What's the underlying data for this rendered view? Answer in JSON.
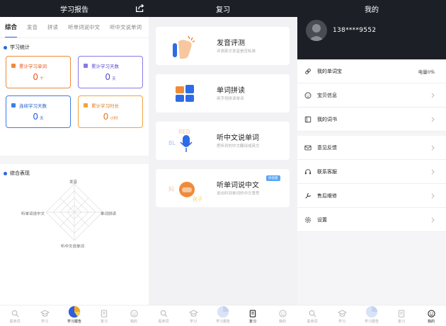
{
  "panel1": {
    "title": "学习报告",
    "tabs": [
      "综合",
      "发音",
      "拼读",
      "听单词说中文",
      "听中文说单词"
    ],
    "stats_title": "学习统计",
    "stats": [
      {
        "label": "累计学习单词",
        "value": "0",
        "unit": "个",
        "color": "#f08a3a",
        "text_color": "#e25c1f"
      },
      {
        "label": "累计学习天数",
        "value": "0",
        "unit": "天",
        "color": "#8b78e6",
        "text_color": "#5b4bd1"
      },
      {
        "label": "连续学习天数",
        "value": "0",
        "unit": "天",
        "color": "#3a7ee8",
        "text_color": "#2560d0"
      },
      {
        "label": "累计学习时长",
        "value": "0",
        "unit": "小时",
        "color": "#f0a43a",
        "text_color": "#e07a1f"
      }
    ],
    "perf_title": "综合表现",
    "radar_labels": {
      "top": "发音",
      "left": "听单词说中文",
      "right": "单词拼读",
      "bottom": "听中文说单词"
    }
  },
  "panel2": {
    "title": "复习",
    "cards": [
      {
        "title": "发音评测",
        "sub": "评测英文发音是否标准"
      },
      {
        "title": "单词拼读",
        "sub": "用字母拼读单词"
      },
      {
        "title": "听中文说单词",
        "sub": "把听到的中文翻译成英文"
      },
      {
        "title": "听单词说中文",
        "sub": "说出听到单词的中文意思",
        "badge": "体验版"
      }
    ]
  },
  "panel3": {
    "title": "我的",
    "phone": "138****9552",
    "menu_group1": [
      {
        "label": "我的单词宝",
        "extra": "电量0%",
        "icon": "link-icon"
      },
      {
        "label": "宝贝信息",
        "icon": "baby-icon"
      },
      {
        "label": "我的词书",
        "icon": "book-icon"
      }
    ],
    "menu_group2": [
      {
        "label": "意见反馈",
        "icon": "mail-icon"
      },
      {
        "label": "联系客服",
        "icon": "headset-icon"
      },
      {
        "label": "售后维修",
        "icon": "wrench-icon"
      },
      {
        "label": "设置",
        "icon": "gear-icon"
      }
    ]
  },
  "tabbar": {
    "items": [
      "看单词",
      "学习",
      "学习报告",
      "复习",
      "我的"
    ]
  },
  "colors": {
    "accent": "#2767e6",
    "dark": "#1d1f26"
  }
}
